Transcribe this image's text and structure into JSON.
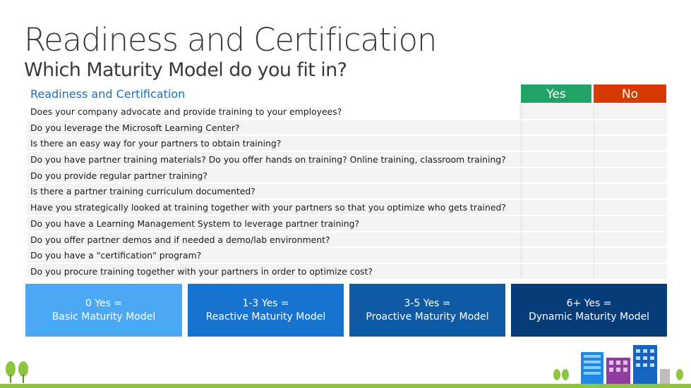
{
  "header": {
    "title": "Readiness and Certification",
    "subtitle": "Which Maturity Model do you fit in?"
  },
  "table": {
    "section_label": "Readiness and Certification",
    "yes_label": "Yes",
    "no_label": "No",
    "questions": [
      "Does your company advocate and provide training to your employees?",
      "Do you leverage the Microsoft Learning Center?",
      "Is there an easy way for your partners to obtain training?",
      "Do you have partner training materials? Do you offer hands on training? Online training, classroom training?",
      "Do you provide regular partner training?",
      "Is there a partner training curriculum documented?",
      "Have you strategically looked at training together with your partners so that you optimize who gets trained?",
      "Do you have a Learning Management System to leverage partner training?",
      "Do you offer partner demos and if needed a demo/lab environment?",
      "Do you have a \"certification\" program?",
      "Do you procure training together with your partners in order to optimize cost?"
    ]
  },
  "models": [
    {
      "line1": "0 Yes =",
      "line2": "Basic Maturity Model"
    },
    {
      "line1": "1-3 Yes =",
      "line2": "Reactive Maturity Model"
    },
    {
      "line1": "3-5 Yes =",
      "line2": "Proactive Maturity Model"
    },
    {
      "line1": "6+ Yes =",
      "line2": "Dynamic Maturity Model"
    }
  ],
  "colors": {
    "yes_header": "#21a366",
    "no_header": "#d83b01",
    "section_label": "#1f6fb2",
    "tile_basic": "#4aa8f4",
    "tile_reactive": "#1773d0",
    "tile_proactive": "#0f5aa5",
    "tile_dynamic": "#063c7a",
    "ground": "#8cc63f"
  },
  "icons": [
    "tree-icon",
    "building-icon"
  ]
}
